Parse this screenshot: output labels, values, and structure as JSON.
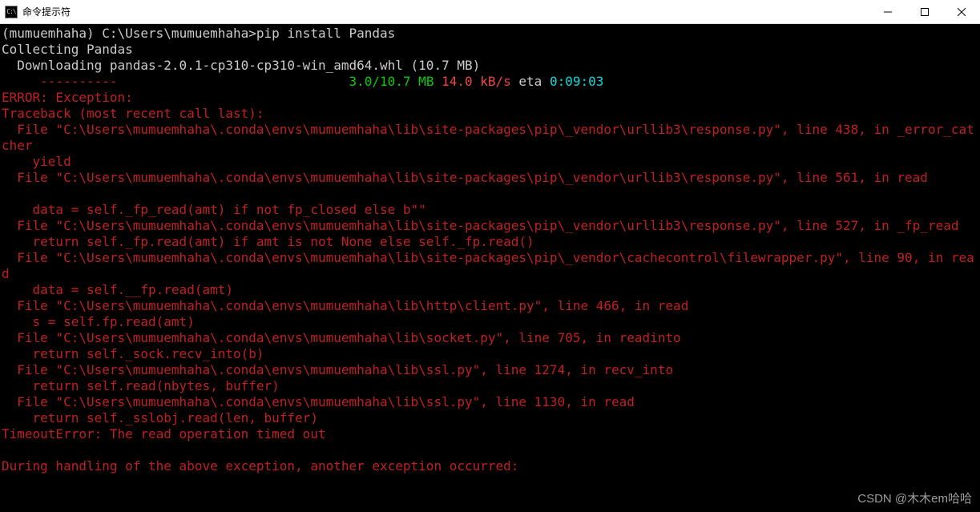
{
  "titlebar": {
    "icon_text": "C:\\",
    "title": "命令提示符"
  },
  "terminal": {
    "prompt_env": "(mumuemhaha) ",
    "prompt_path": "C:\\Users\\mumuemhaha>",
    "command": "pip install Pandas",
    "collecting": "Collecting Pandas",
    "downloading": "  Downloading pandas-2.0.1-cp310-cp310-win_amd64.whl (10.7 MB)",
    "progress_prefix": "     ",
    "progress_dashes": "----------",
    "progress_spaces": "                              ",
    "progress_size": "3.0/10.7 MB",
    "progress_speed": " 14.0 kB/s",
    "progress_eta_label": " eta ",
    "progress_eta": "0:09:03",
    "err": {
      "l1": "ERROR: Exception:",
      "l2": "Traceback (most recent call last):",
      "l3": "  File \"C:\\Users\\mumuemhaha\\.conda\\envs\\mumuemhaha\\lib\\site-packages\\pip\\_vendor\\urllib3\\response.py\", line 438, in _error_catcher",
      "l4": "    yield",
      "l5": "  File \"C:\\Users\\mumuemhaha\\.conda\\envs\\mumuemhaha\\lib\\site-packages\\pip\\_vendor\\urllib3\\response.py\", line 561, in read",
      "l6": "    data = self._fp_read(amt) if not fp_closed else b\"\"",
      "l7": "  File \"C:\\Users\\mumuemhaha\\.conda\\envs\\mumuemhaha\\lib\\site-packages\\pip\\_vendor\\urllib3\\response.py\", line 527, in _fp_read",
      "l8": "    return self._fp.read(amt) if amt is not None else self._fp.read()",
      "l9": "  File \"C:\\Users\\mumuemhaha\\.conda\\envs\\mumuemhaha\\lib\\site-packages\\pip\\_vendor\\cachecontrol\\filewrapper.py\", line 90, in read",
      "l10": "    data = self.__fp.read(amt)",
      "l11": "  File \"C:\\Users\\mumuemhaha\\.conda\\envs\\mumuemhaha\\lib\\http\\client.py\", line 466, in read",
      "l12": "    s = self.fp.read(amt)",
      "l13": "  File \"C:\\Users\\mumuemhaha\\.conda\\envs\\mumuemhaha\\lib\\socket.py\", line 705, in readinto",
      "l14": "    return self._sock.recv_into(b)",
      "l15": "  File \"C:\\Users\\mumuemhaha\\.conda\\envs\\mumuemhaha\\lib\\ssl.py\", line 1274, in recv_into",
      "l16": "    return self.read(nbytes, buffer)",
      "l17": "  File \"C:\\Users\\mumuemhaha\\.conda\\envs\\mumuemhaha\\lib\\ssl.py\", line 1130, in read",
      "l18": "    return self._sslobj.read(len, buffer)",
      "l19": "TimeoutError: The read operation timed out",
      "l20": "",
      "l21": "During handling of the above exception, another exception occurred:"
    }
  },
  "watermark": "CSDN @木木em哈哈"
}
